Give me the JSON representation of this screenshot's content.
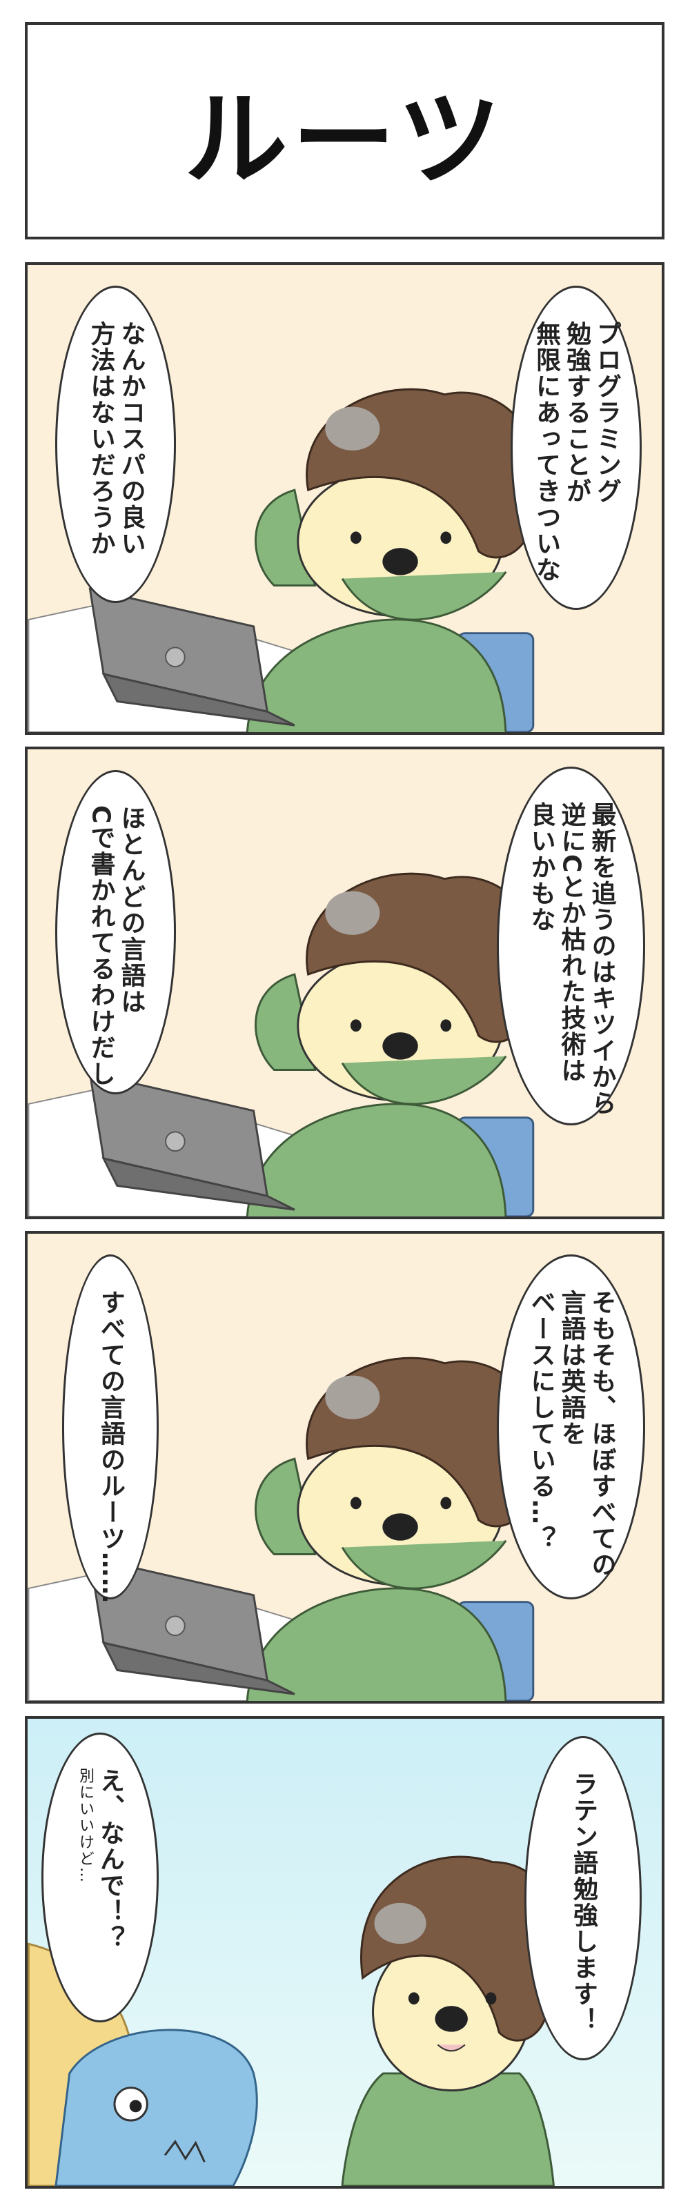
{
  "title": "ルーツ",
  "colors": {
    "panel_bg": "#fdf0da",
    "sky_bg": "#cdeff7",
    "hair": "#7a5a43",
    "skin": "#fbf1c3",
    "sweater": "#88b77d",
    "chair": "#7ba7d6",
    "laptop": "#8e8e8e",
    "shark": "#8fc3e6"
  },
  "panels": [
    {
      "bubble_right": [
        "プログラミング",
        "勉強することが",
        "無限にあってきついな"
      ],
      "bubble_left": [
        "なんかコスパの良い",
        "方法はないだろうか"
      ]
    },
    {
      "bubble_right": [
        "最新を追うのはキツイから",
        "逆にCとか枯れた技術は",
        "良いかもな"
      ],
      "bubble_left": [
        "ほとんどの言語は",
        "Cで書かれてるわけだし"
      ]
    },
    {
      "bubble_right": [
        "そもそも、ほぼすべての",
        "言語は英語を",
        "ベースにしている…？"
      ],
      "bubble_left": [
        "すべての言語のルーツ……"
      ]
    },
    {
      "bubble_right": [
        "ラテン語勉強します！"
      ],
      "bubble_left": [
        "え、なんで！？"
      ],
      "bubble_left_small": "別にいいけど…"
    }
  ]
}
